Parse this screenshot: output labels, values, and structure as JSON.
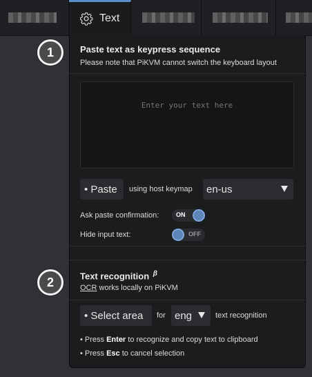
{
  "tabs": [
    {
      "label": ""
    },
    {
      "label": "Text",
      "icon": "gear-icon",
      "active": true
    },
    {
      "label": ""
    },
    {
      "label": ""
    },
    {
      "label": ""
    }
  ],
  "paste": {
    "step": "1",
    "title": "Paste text as keypress sequence",
    "note": "Please note that PiKVM cannot switch the keyboard layout",
    "placeholder": "Enter your text here",
    "paste_button": "• Paste",
    "using_label": "using host keymap",
    "keymap": "en-us",
    "ask_confirm_label": "Ask paste confirmation:",
    "ask_confirm_state": "ON",
    "hide_input_label": "Hide input text:",
    "hide_input_state": "OFF"
  },
  "ocr": {
    "step": "2",
    "title": "Text recognition",
    "beta": "β",
    "note_link": "OCR",
    "note_rest": " works locally on PiKVM",
    "select_button": "• Select area",
    "for_label": "for",
    "lang": "eng",
    "after_label": "text recognition",
    "hint1_pre": "• Press ",
    "hint1_key": "Enter",
    "hint1_post": " to recognize and copy text to clipboard",
    "hint2_pre": "• Press ",
    "hint2_key": "Esc",
    "hint2_post": " to cancel selection"
  },
  "colors": {
    "accent": "#5b8ec7",
    "panel": "#1b1c1e",
    "background": "#2f3136"
  }
}
